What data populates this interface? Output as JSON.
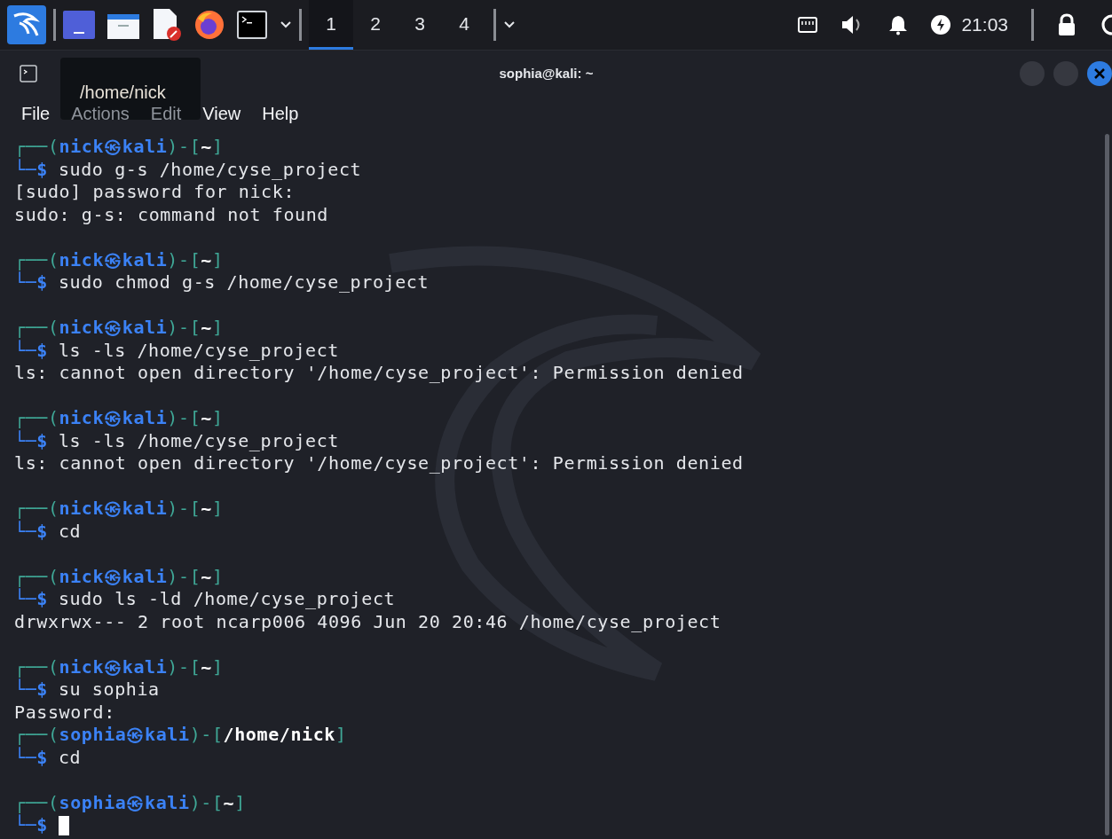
{
  "taskbar": {
    "workspaces": [
      {
        "label": "1",
        "selected": true
      },
      {
        "label": "2",
        "selected": false
      },
      {
        "label": "3",
        "selected": false
      },
      {
        "label": "4",
        "selected": false
      }
    ],
    "clock": "21:03"
  },
  "window": {
    "title": "sophia@kali: ~",
    "tooltip": "/home/nick"
  },
  "menu": [
    "File",
    "Actions",
    "Edit",
    "View",
    "Help"
  ],
  "prompt_format": {
    "open": "┌──(",
    "at": "㉿",
    "mid": ")-[",
    "close": "]",
    "second": "└─$"
  },
  "blocks": [
    {
      "user": "nick",
      "host": "kali",
      "dir": "~",
      "command": "sudo g-s /home/cyse_project",
      "output": [
        "[sudo] password for nick:",
        "sudo: g-s: command not found"
      ]
    },
    {
      "user": "nick",
      "host": "kali",
      "dir": "~",
      "command": "sudo chmod g-s /home/cyse_project"
    },
    {
      "user": "nick",
      "host": "kali",
      "dir": "~",
      "command": "ls -ls /home/cyse_project",
      "output": [
        "ls: cannot open directory '/home/cyse_project': Permission denied"
      ]
    },
    {
      "user": "nick",
      "host": "kali",
      "dir": "~",
      "command": "ls -ls /home/cyse_project",
      "output": [
        "ls: cannot open directory '/home/cyse_project': Permission denied"
      ]
    },
    {
      "user": "nick",
      "host": "kali",
      "dir": "~",
      "command": "cd"
    },
    {
      "user": "nick",
      "host": "kali",
      "dir": "~",
      "command": "sudo ls -ld /home/cyse_project",
      "output": [
        "drwxrwx--- 2 root ncarp006 4096 Jun 20 20:46 /home/cyse_project"
      ]
    },
    {
      "user": "nick",
      "host": "kali",
      "dir": "~",
      "command": "su sophia",
      "output": [
        "Password:"
      ],
      "joined": true
    },
    {
      "user": "sophia",
      "host": "kali",
      "dir": "/home/nick",
      "command": "cd"
    },
    {
      "user": "sophia",
      "host": "kali",
      "dir": "~",
      "cursor": true
    }
  ]
}
